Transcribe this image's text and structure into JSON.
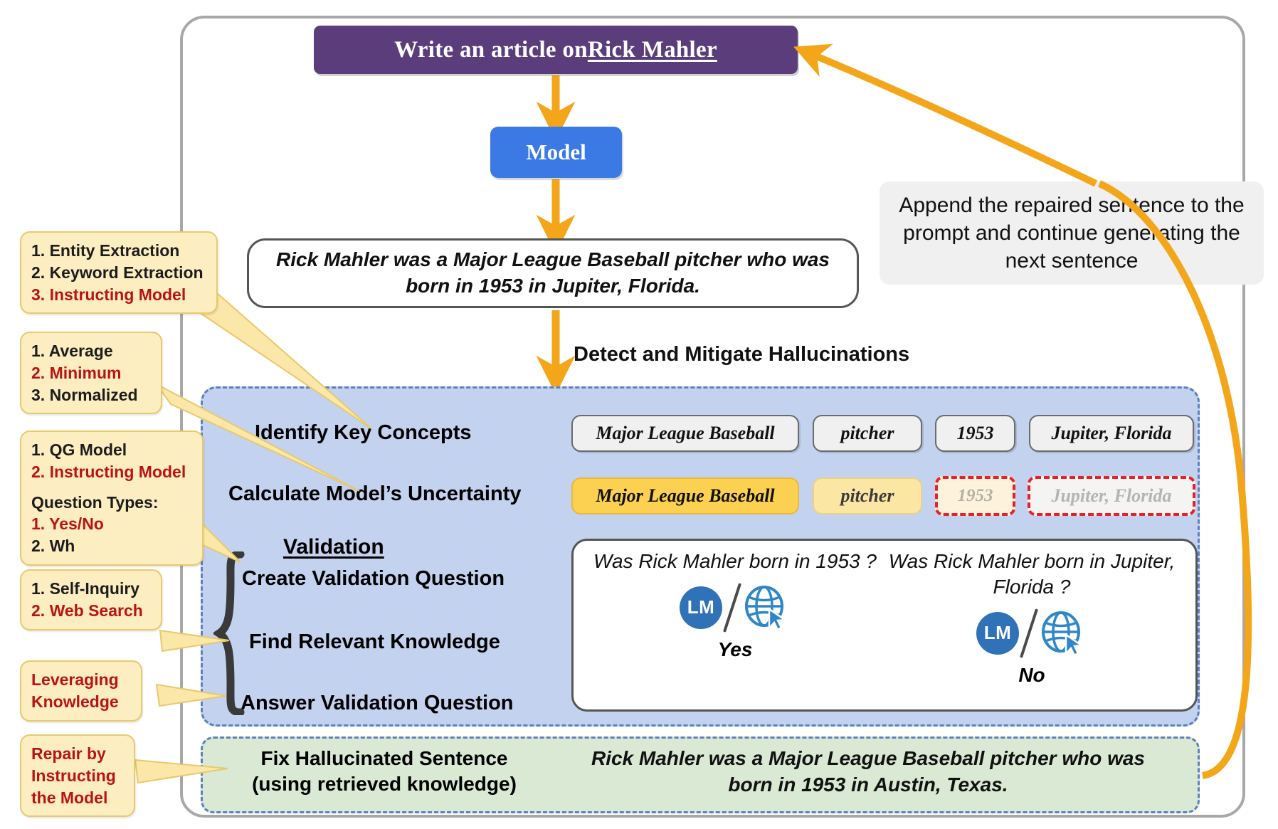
{
  "prompt": {
    "prefix": "Write an article on ",
    "entity": "Rick Mahler"
  },
  "model": {
    "label": "Model"
  },
  "generated_sentence": "Rick Mahler was a Major League Baseball pitcher who was born in 1953 in Jupiter, Florida.",
  "detect_label": "Detect and Mitigate Hallucinations",
  "append_note": "Append the repaired sentence to the prompt and continue generating the next sentence",
  "rows": {
    "identify": "Identify Key Concepts",
    "uncertainty": "Calculate Model’s Uncertainty",
    "validation_heading": "Validation",
    "create_question": "Create Validation Question",
    "find_knowledge": "Find Relevant Knowledge",
    "answer_question": "Answer Validation Question"
  },
  "concepts": [
    {
      "text": "Major League Baseball"
    },
    {
      "text": "pitcher"
    },
    {
      "text": "1953"
    },
    {
      "text": "Jupiter, Florida"
    }
  ],
  "uncertainty": [
    {
      "text": "Major League Baseball",
      "state": "high-confidence"
    },
    {
      "text": "pitcher",
      "state": "mid-confidence"
    },
    {
      "text": "1953",
      "state": "flagged"
    },
    {
      "text": "Jupiter, Florida",
      "state": "flagged"
    }
  ],
  "qa": [
    {
      "question": "Was Rick Mahler born in 1953 ?",
      "lm_label": "LM",
      "answer": "Yes"
    },
    {
      "question": "Was Rick Mahler born in Jupiter, Florida ?",
      "lm_label": "LM",
      "answer": "No"
    }
  ],
  "fix": {
    "label_line1": "Fix Hallucinated Sentence",
    "label_line2": "(using retrieved knowledge)",
    "sentence": "Rick Mahler was a Major League Baseball pitcher who was born in 1953 in Austin, Texas."
  },
  "callouts": {
    "key_concepts": {
      "items": [
        {
          "text": "1. Entity Extraction",
          "highlight": false
        },
        {
          "text": "2. Keyword Extraction",
          "highlight": false
        },
        {
          "text": "3. Instructing Model",
          "highlight": true
        }
      ]
    },
    "uncertainty": {
      "items": [
        {
          "text": "1. Average",
          "highlight": false
        },
        {
          "text": "2. Minimum",
          "highlight": true
        },
        {
          "text": "3. Normalized",
          "highlight": false
        }
      ]
    },
    "question_gen": {
      "items": [
        {
          "text": "1. QG Model",
          "highlight": false
        },
        {
          "text": "2. Instructing Model",
          "highlight": true
        },
        {
          "text": "",
          "highlight": false
        },
        {
          "text": "Question Types:",
          "highlight": false
        },
        {
          "text": "1. Yes/No",
          "highlight": true
        },
        {
          "text": "2. Wh",
          "highlight": false
        }
      ]
    },
    "knowledge": {
      "items": [
        {
          "text": "1. Self-Inquiry",
          "highlight": false
        },
        {
          "text": "2. Web Search",
          "highlight": true
        }
      ]
    },
    "answering": {
      "items": [
        {
          "text": "Leveraging",
          "highlight": true
        },
        {
          "text": "Knowledge",
          "highlight": true
        }
      ]
    },
    "repair": {
      "items": [
        {
          "text": "Repair by",
          "highlight": true
        },
        {
          "text": "Instructing",
          "highlight": true
        },
        {
          "text": "the Model",
          "highlight": true
        }
      ]
    }
  },
  "colors": {
    "prompt_purple": "#5b3d7c",
    "model_blue": "#3b7ae4",
    "arrow_orange": "#f4a61b",
    "panel_blue": "#c2d2ef",
    "panel_green": "#dae9d4",
    "callout_yellow": "#fdeec2",
    "highlight_red": "#b81414",
    "chip_high": "#fcd152",
    "chip_mid": "#fbe6a4",
    "flag_red": "#e8202a",
    "lm_blue": "#2f72b8",
    "globe_blue": "#2f86c8"
  }
}
